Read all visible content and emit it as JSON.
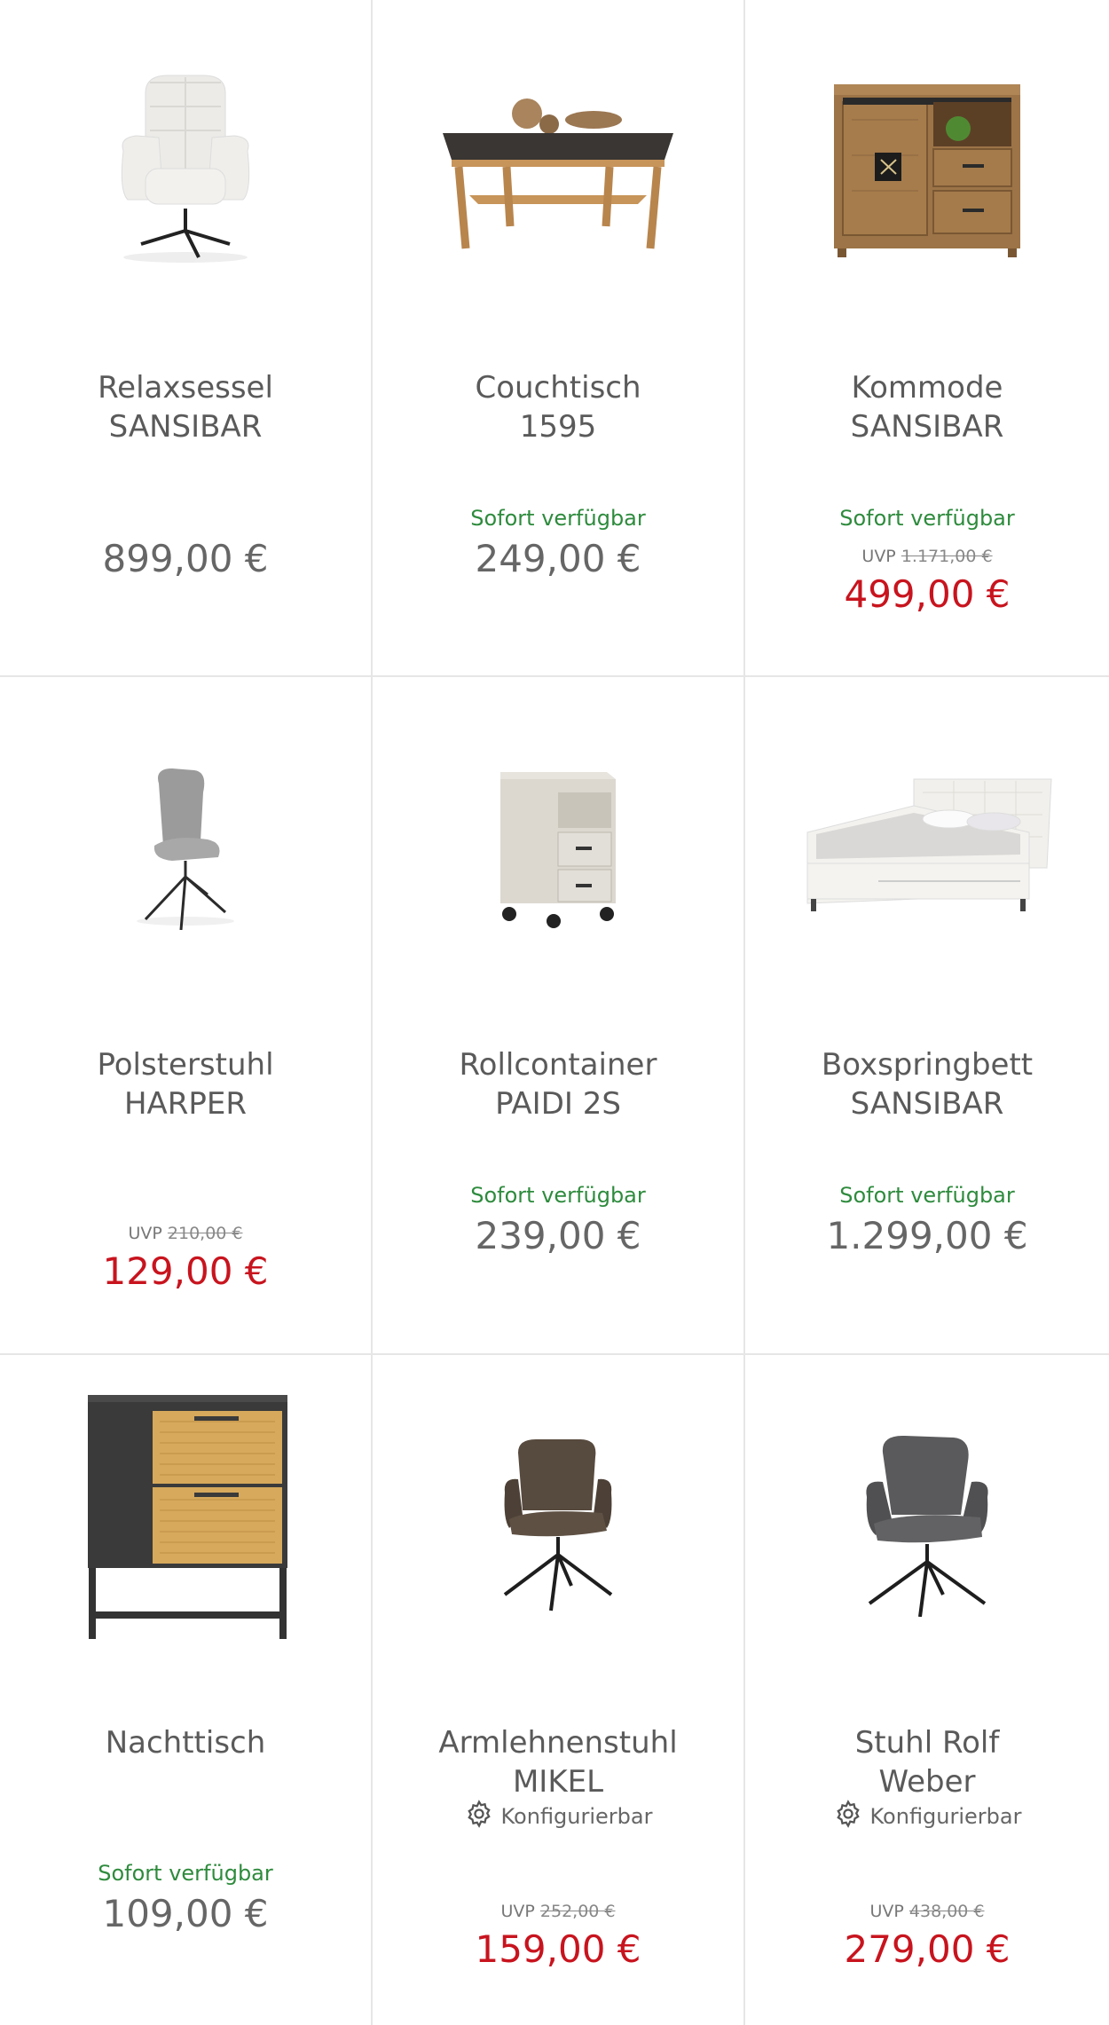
{
  "labels": {
    "available": "Sofort verfügbar",
    "uvp_prefix": "UVP",
    "configurable": "Konfigurierbar"
  },
  "products": [
    {
      "name": "Relaxsessel\nSANSIBAR",
      "price": "899,00 €",
      "icon": "recliner-chair-image"
    },
    {
      "name": "Couchtisch\n1595",
      "availability": "Sofort verfügbar",
      "price": "249,00 €",
      "icon": "coffee-table-image"
    },
    {
      "name": "Kommode\nSANSIBAR",
      "availability": "Sofort verfügbar",
      "uvp": "1.171,00 €",
      "price": "499,00 €",
      "on_sale": true,
      "icon": "sideboard-image"
    },
    {
      "name": "Polsterstuhl\nHARPER",
      "uvp": "210,00 €",
      "price": "129,00 €",
      "on_sale": true,
      "icon": "upholstered-chair-image"
    },
    {
      "name": "Rollcontainer\nPAIDI 2S",
      "availability": "Sofort verfügbar",
      "price": "239,00 €",
      "icon": "rolling-cabinet-image"
    },
    {
      "name": "Boxspringbett\nSANSIBAR",
      "availability": "Sofort verfügbar",
      "price": "1.299,00 €",
      "icon": "boxspring-bed-image"
    },
    {
      "name": "Nachttisch",
      "availability": "Sofort verfügbar",
      "price": "109,00 €",
      "icon": "nightstand-image"
    },
    {
      "name": "Armlehnenstuhl\nMIKEL",
      "configurable": true,
      "uvp": "252,00 €",
      "price": "159,00 €",
      "on_sale": true,
      "icon": "armchair-brown-image"
    },
    {
      "name": "Stuhl Rolf\nWeber",
      "configurable": true,
      "uvp": "438,00 €",
      "price": "279,00 €",
      "on_sale": true,
      "icon": "armchair-grey-image"
    }
  ],
  "colors": {
    "sale_price": "#c8141e",
    "availability": "#2e8b3d",
    "divider": "#e6e6e6"
  }
}
